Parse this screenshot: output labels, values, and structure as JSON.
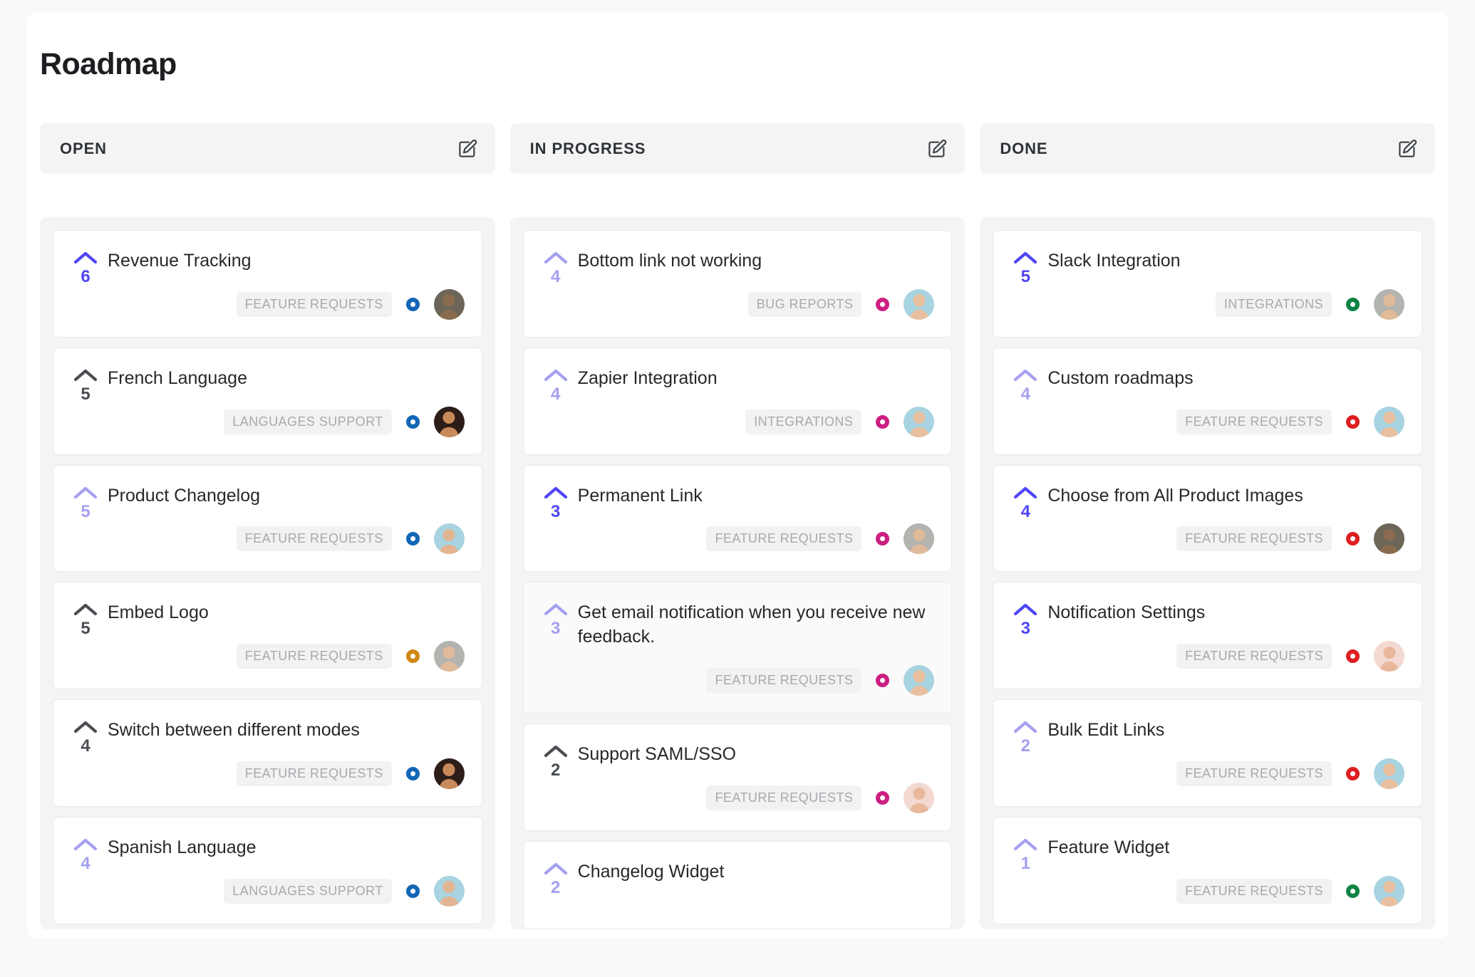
{
  "page": {
    "title": "Roadmap"
  },
  "icons": {
    "edit": "square-pen-icon",
    "upvote": "chevron-up-icon"
  },
  "colors": {
    "vote_strong": "#4f46f5",
    "vote_light": "#a5a0f0",
    "vote_gray": "#4a4e53",
    "status_blue": "#1266b5",
    "status_orange": "#d08712",
    "status_pink": "#cc1f82",
    "status_green": "#0f8344",
    "status_red": "#de1f20",
    "badge_bg": "#f2f2f3",
    "badge_text": "#a7a9ad",
    "column_bg": "#f4f4f5",
    "card_bg": "#ffffff",
    "page_bg": "#f8f9fa"
  },
  "columns": [
    {
      "id": "open",
      "title": "OPEN",
      "edit_label": "Edit column",
      "cards": [
        {
          "title": "Revenue Tracking",
          "votes": "6",
          "vote_color": "#4f46f5",
          "badge": "FEATURE REQUESTS",
          "status_color": "#1266b5",
          "avatar_skin": "#8a6b4f",
          "avatar_bg": "#6b6657",
          "hovered": false
        },
        {
          "title": "French Language",
          "votes": "5",
          "vote_color": "#4a4e53",
          "badge": "LANGUAGES SUPPORT",
          "status_color": "#1266b5",
          "avatar_skin": "#c98a5a",
          "avatar_bg": "#2d1d18",
          "hovered": false
        },
        {
          "title": "Product Changelog",
          "votes": "5",
          "vote_color": "#a5a0f0",
          "badge": "FEATURE REQUESTS",
          "status_color": "#1266b5",
          "avatar_skin": "#e3b491",
          "avatar_bg": "#a8d3e0",
          "hovered": false
        },
        {
          "title": "Embed Logo",
          "votes": "5",
          "vote_color": "#4a4e53",
          "badge": "FEATURE REQUESTS",
          "status_color": "#d08712",
          "avatar_skin": "#e0bb99",
          "avatar_bg": "#b3b3b0",
          "hovered": false
        },
        {
          "title": "Switch between different modes",
          "votes": "4",
          "vote_color": "#4a4e53",
          "badge": "FEATURE REQUESTS",
          "status_color": "#1266b5",
          "avatar_skin": "#c98a5a",
          "avatar_bg": "#2d1d18",
          "hovered": false
        },
        {
          "title": "Spanish Language",
          "votes": "4",
          "vote_color": "#a5a0f0",
          "badge": "LANGUAGES SUPPORT",
          "status_color": "#1266b5",
          "avatar_skin": "#e3b491",
          "avatar_bg": "#a8d3e0",
          "hovered": false
        }
      ]
    },
    {
      "id": "in-progress",
      "title": "IN PROGRESS",
      "edit_label": "Edit column",
      "cards": [
        {
          "title": "Bottom link not working",
          "votes": "4",
          "vote_color": "#a5a0f0",
          "badge": "BUG REPORTS",
          "status_color": "#cc1f82",
          "avatar_skin": "#e8c0a0",
          "avatar_bg": "#a8d3e0",
          "hovered": false
        },
        {
          "title": "Zapier Integration",
          "votes": "4",
          "vote_color": "#a5a0f0",
          "badge": "INTEGRATIONS",
          "status_color": "#cc1f82",
          "avatar_skin": "#e8c0a0",
          "avatar_bg": "#a8d3e0",
          "hovered": false
        },
        {
          "title": "Permanent Link",
          "votes": "3",
          "vote_color": "#4f46f5",
          "badge": "FEATURE REQUESTS",
          "status_color": "#cc1f82",
          "avatar_skin": "#e0bb99",
          "avatar_bg": "#b3b3b0",
          "hovered": false
        },
        {
          "title": "Get email notification when you receive new feedback.",
          "votes": "3",
          "vote_color": "#a5a0f0",
          "badge": "FEATURE REQUESTS",
          "status_color": "#cc1f82",
          "avatar_skin": "#e8c0a0",
          "avatar_bg": "#a8d3e0",
          "hovered": true
        },
        {
          "title": "Support SAML/SSO",
          "votes": "2",
          "vote_color": "#4a4e53",
          "badge": "FEATURE REQUESTS",
          "status_color": "#cc1f82",
          "avatar_skin": "#e9b79c",
          "avatar_bg": "#f3d9d2",
          "hovered": false
        },
        {
          "title": "Changelog Widget",
          "votes": "2",
          "vote_color": "#a5a0f0",
          "badge": "",
          "status_color": "",
          "avatar_skin": "",
          "avatar_bg": "",
          "hovered": false
        }
      ]
    },
    {
      "id": "done",
      "title": "DONE",
      "edit_label": "Edit column",
      "cards": [
        {
          "title": "Slack Integration",
          "votes": "5",
          "vote_color": "#4f46f5",
          "badge": "INTEGRATIONS",
          "status_color": "#0f8344",
          "avatar_skin": "#e0bb99",
          "avatar_bg": "#b3b3b0",
          "hovered": false
        },
        {
          "title": "Custom roadmaps",
          "votes": "4",
          "vote_color": "#a5a0f0",
          "badge": "FEATURE REQUESTS",
          "status_color": "#de1f20",
          "avatar_skin": "#e8c0a0",
          "avatar_bg": "#a8d3e0",
          "hovered": false
        },
        {
          "title": "Choose from All Product Images",
          "votes": "4",
          "vote_color": "#4f46f5",
          "badge": "FEATURE REQUESTS",
          "status_color": "#de1f20",
          "avatar_skin": "#8a6b4f",
          "avatar_bg": "#6b6657",
          "hovered": false
        },
        {
          "title": "Notification Settings",
          "votes": "3",
          "vote_color": "#4f46f5",
          "badge": "FEATURE REQUESTS",
          "status_color": "#de1f20",
          "avatar_skin": "#e9b79c",
          "avatar_bg": "#f3d9d2",
          "hovered": false
        },
        {
          "title": "Bulk Edit Links",
          "votes": "2",
          "vote_color": "#a5a0f0",
          "badge": "FEATURE REQUESTS",
          "status_color": "#de1f20",
          "avatar_skin": "#e8c0a0",
          "avatar_bg": "#a8d3e0",
          "hovered": false
        },
        {
          "title": "Feature Widget",
          "votes": "1",
          "vote_color": "#a5a0f0",
          "badge": "FEATURE REQUESTS",
          "status_color": "#0f8344",
          "avatar_skin": "#e8c0a0",
          "avatar_bg": "#a8d3e0",
          "hovered": false
        }
      ]
    }
  ]
}
